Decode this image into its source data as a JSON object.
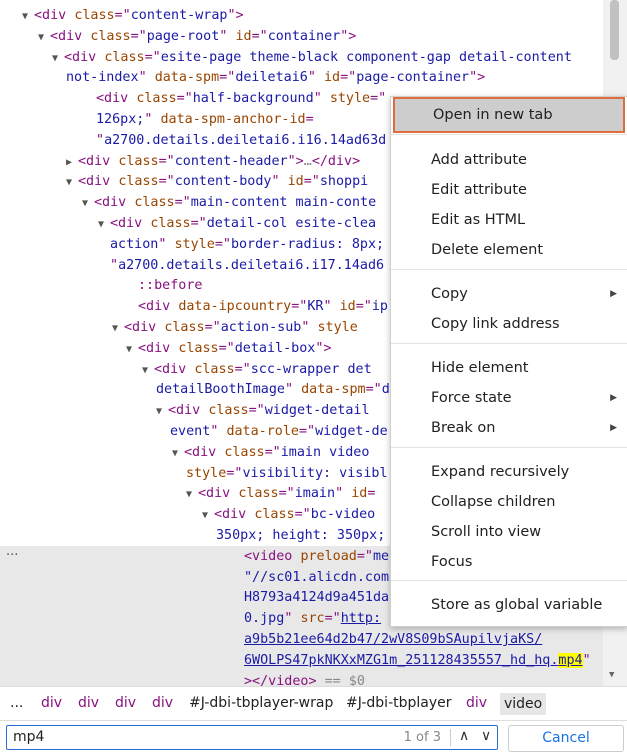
{
  "lines": [
    {
      "indent": 36,
      "tri": "▼",
      "html": "<span class=\"tag\">&lt;div</span> <span class=\"an\">class</span><span class=\"tag\">=\"</span><span class=\"av\">content-wrap</span><span class=\"tag\">\"&gt;</span>"
    },
    {
      "indent": 52,
      "tri": "▼",
      "html": "<span class=\"tag\">&lt;div</span> <span class=\"an\">class</span><span class=\"tag\">=\"</span><span class=\"av\">page-root</span><span class=\"tag\">\"</span> <span class=\"an\">id</span><span class=\"tag\">=\"</span><span class=\"av\">container</span><span class=\"tag\">\"&gt;</span>"
    },
    {
      "indent": 66,
      "tri": "▼",
      "html": "<span class=\"tag\">&lt;div</span> <span class=\"an\">class</span><span class=\"tag\">=\"</span><span class=\"av\">esite-page theme-black component-gap detail-content</span>"
    },
    {
      "indent": 66,
      "tri": "",
      "html": "<span class=\"av\">not-index</span><span class=\"tag\">\"</span> <span class=\"an\">data-spm</span><span class=\"tag\">=\"</span><span class=\"av\">deiletai6</span><span class=\"tag\">\"</span> <span class=\"an\">id</span><span class=\"tag\">=\"</span><span class=\"av\">page-container</span><span class=\"tag\">\"&gt;</span>"
    },
    {
      "indent": 96,
      "tri": "",
      "html": "<span class=\"tag\">&lt;div</span> <span class=\"an\">class</span><span class=\"tag\">=\"</span><span class=\"av\">half-background</span><span class=\"tag\">\"</span> <span class=\"an\">style</span><span class=\"tag\">=\"</span>"
    },
    {
      "indent": 96,
      "tri": "",
      "html": "<span class=\"av\">126px;</span><span class=\"tag\">\"</span> <span class=\"an\">data-spm-anchor-id</span><span class=\"tag\">=</span>"
    },
    {
      "indent": 96,
      "tri": "",
      "html": "<span class=\"tag\">\"</span><span class=\"av\">a2700.details.deiletai6.i16.14ad63d</span>"
    },
    {
      "indent": 80,
      "tri": "▶",
      "html": "<span class=\"tag\">&lt;div</span> <span class=\"an\">class</span><span class=\"tag\">=\"</span><span class=\"av\">content-header</span><span class=\"tag\">\"&gt;</span><span class=\"gray\">…</span><span class=\"tag\">&lt;/div&gt;</span>"
    },
    {
      "indent": 80,
      "tri": "▼",
      "html": "<span class=\"tag\">&lt;div</span> <span class=\"an\">class</span><span class=\"tag\">=\"</span><span class=\"av\">content-body</span><span class=\"tag\">\"</span> <span class=\"an\">id</span><span class=\"tag\">=\"</span><span class=\"av\">shoppi</span>"
    },
    {
      "indent": 96,
      "tri": "▼",
      "html": "<span class=\"tag\">&lt;div</span> <span class=\"an\">class</span><span class=\"tag\">=\"</span><span class=\"av\">main-content main-conte</span>"
    },
    {
      "indent": 112,
      "tri": "▼",
      "html": "<span class=\"tag\">&lt;div</span> <span class=\"an\">class</span><span class=\"tag\">=\"</span><span class=\"av\">detail-col esite-clea</span>"
    },
    {
      "indent": 110,
      "tri": "",
      "html": "<span class=\"av\">action</span><span class=\"tag\">\"</span> <span class=\"an\">style</span><span class=\"tag\">=\"</span><span class=\"av\">border-radius: 8px;</span>"
    },
    {
      "indent": 110,
      "tri": "",
      "html": "<span class=\"tag\">\"</span><span class=\"av\">a2700.details.deiletai6.i17.14ad6</span>"
    },
    {
      "indent": 138,
      "tri": "",
      "html": "<span class=\"pseudo\">::before</span>"
    },
    {
      "indent": 138,
      "tri": "",
      "html": "<span class=\"tag\">&lt;div</span> <span class=\"an\">data-ipcountry</span><span class=\"tag\">=\"</span><span class=\"av\">KR</span><span class=\"tag\">\"</span> <span class=\"an\">id</span><span class=\"tag\">=\"</span><span class=\"av\">ip</span>"
    },
    {
      "indent": 126,
      "tri": "▼",
      "html": "<span class=\"tag\">&lt;div</span> <span class=\"an\">class</span><span class=\"tag\">=\"</span><span class=\"av\">action-sub</span><span class=\"tag\">\"</span> <span class=\"an\">style</span>"
    },
    {
      "indent": 140,
      "tri": "▼",
      "html": "<span class=\"tag\">&lt;div</span> <span class=\"an\">class</span><span class=\"tag\">=\"</span><span class=\"av\">detail-box</span><span class=\"tag\">\"&gt;</span>"
    },
    {
      "indent": 156,
      "tri": "▼",
      "html": "<span class=\"tag\">&lt;div</span> <span class=\"an\">class</span><span class=\"tag\">=\"</span><span class=\"av\">scc-wrapper det</span>"
    },
    {
      "indent": 156,
      "tri": "",
      "html": "<span class=\"av\">detailBoothImage</span><span class=\"tag\">\"</span> <span class=\"an\">data-spm</span><span class=\"tag\">=\"</span><span class=\"av\">d</span>"
    },
    {
      "indent": 170,
      "tri": "▼",
      "html": "<span class=\"tag\">&lt;div</span> <span class=\"an\">class</span><span class=\"tag\">=\"</span><span class=\"av\">widget-detail</span>"
    },
    {
      "indent": 170,
      "tri": "",
      "html": "<span class=\"av\">event</span><span class=\"tag\">\"</span> <span class=\"an\">data-role</span><span class=\"tag\">=\"</span><span class=\"av\">widget-de</span>"
    },
    {
      "indent": 186,
      "tri": "▼",
      "html": "<span class=\"tag\">&lt;div</span> <span class=\"an\">class</span><span class=\"tag\">=\"</span><span class=\"av\">imain video</span>"
    },
    {
      "indent": 186,
      "tri": "",
      "html": "<span class=\"an\">style</span><span class=\"tag\">=\"</span><span class=\"av\">visibility: visibl</span>"
    },
    {
      "indent": 200,
      "tri": "▼",
      "html": "<span class=\"tag\">&lt;div</span> <span class=\"an\">class</span><span class=\"tag\">=\"</span><span class=\"av\">imain</span><span class=\"tag\">\"</span> <span class=\"an\">id</span><span class=\"tag\">=</span>"
    },
    {
      "indent": 216,
      "tri": "▼",
      "html": "<span class=\"tag\">&lt;div</span> <span class=\"an\">class</span><span class=\"tag\">=\"</span><span class=\"av\">bc-video</span>"
    },
    {
      "indent": 216,
      "tri": "",
      "html": "<span class=\"av\">350px; height: 350px;</span>"
    },
    {
      "indent": 244,
      "tri": "",
      "sel": true,
      "html": "<span class=\"tag\">&lt;video</span> <span class=\"an\">preload</span><span class=\"tag\">=\"</span><span class=\"av\">me</span>"
    },
    {
      "indent": 244,
      "tri": "",
      "sel": true,
      "html": "<span class=\"av\">\"//sc01.alicdn.com</span>"
    },
    {
      "indent": 244,
      "tri": "",
      "sel": true,
      "html": "<span class=\"av\">H8793a4124d9a451da</span>"
    },
    {
      "indent": 244,
      "tri": "",
      "sel": true,
      "html": "<span class=\"av\">0.jpg</span><span class=\"tag\">\"</span> <span class=\"an\">src</span><span class=\"tag\">=\"</span><span class=\"av link\">http:</span>"
    },
    {
      "indent": 244,
      "tri": "",
      "sel": true,
      "html": "<span class=\"av link\">a9b5b21ee64d2b47/2wV8S09bSAupilvjaKS/</span>"
    },
    {
      "indent": 244,
      "tri": "",
      "sel": true,
      "html": "<span class=\"av link\">6WOLPS47pkNKXxMZG1m_251128435557_hd_hq.</span><span class=\"av link hl\">mp4</span><span class=\"tag\">\"</span>"
    },
    {
      "indent": 244,
      "tri": "",
      "sel": true,
      "html": "<span class=\"tag\">&gt;&lt;/video&gt;</span> <span class=\"gray\">== $0</span>"
    }
  ],
  "dots": "...",
  "breadcrumbs": [
    {
      "label": "...",
      "cls": "idc"
    },
    {
      "label": "div",
      "cls": "tagc"
    },
    {
      "label": "div",
      "cls": "tagc"
    },
    {
      "label": "div",
      "cls": "tagc"
    },
    {
      "label": "div",
      "cls": "tagc"
    },
    {
      "label": "#J-dbi-tbplayer-wrap",
      "cls": "idc"
    },
    {
      "label": "#J-dbi-tbplayer",
      "cls": "idc"
    },
    {
      "label": "div",
      "cls": "tagc"
    },
    {
      "label": "video",
      "cls": "idc active"
    }
  ],
  "search": {
    "value": "mp4",
    "count": "1 of 3",
    "up": "∧",
    "down": "∨",
    "cancel": "Cancel"
  },
  "menu": {
    "items": [
      {
        "label": "Open in new tab",
        "name": "menu-open-new-tab",
        "sub": false
      },
      {
        "label": "Add attribute",
        "name": "menu-add-attribute",
        "sub": false
      },
      {
        "label": "Edit attribute",
        "name": "menu-edit-attribute",
        "sub": false
      },
      {
        "label": "Edit as HTML",
        "name": "menu-edit-as-html",
        "sub": false
      },
      {
        "label": "Delete element",
        "name": "menu-delete-element",
        "sub": false
      },
      {
        "label": "Copy",
        "name": "menu-copy",
        "sub": true
      },
      {
        "label": "Copy link address",
        "name": "menu-copy-link-address",
        "sub": false
      },
      {
        "label": "Hide element",
        "name": "menu-hide-element",
        "sub": false
      },
      {
        "label": "Force state",
        "name": "menu-force-state",
        "sub": true
      },
      {
        "label": "Break on",
        "name": "menu-break-on",
        "sub": true
      },
      {
        "label": "Expand recursively",
        "name": "menu-expand-recursively",
        "sub": false
      },
      {
        "label": "Collapse children",
        "name": "menu-collapse-children",
        "sub": false
      },
      {
        "label": "Scroll into view",
        "name": "menu-scroll-into-view",
        "sub": false
      },
      {
        "label": "Focus",
        "name": "menu-focus",
        "sub": false
      },
      {
        "label": "Store as global variable",
        "name": "menu-store-global-variable",
        "sub": false
      }
    ],
    "submenu_icon": "▶"
  }
}
